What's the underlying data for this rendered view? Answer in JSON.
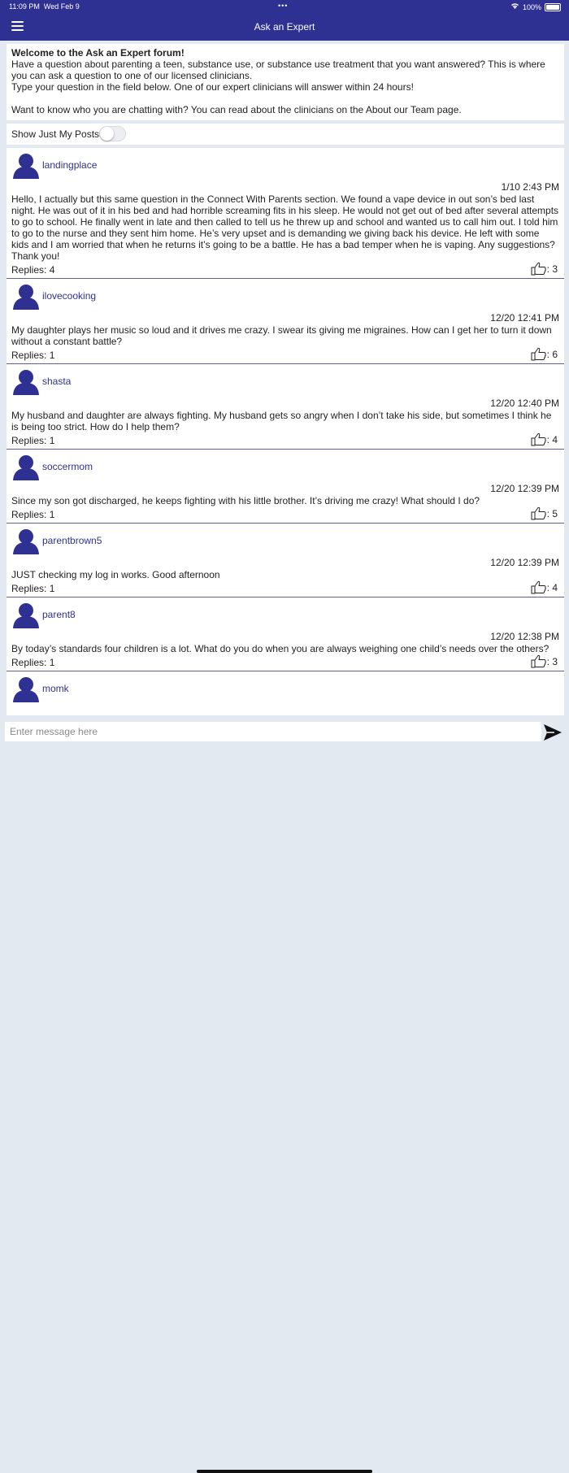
{
  "status_bar": {
    "time": "11:09 PM",
    "date": "Wed Feb 9",
    "dots": "•••",
    "wifi_icon": "wifi-icon",
    "battery": "100%"
  },
  "nav": {
    "title": "Ask an Expert",
    "menu_icon": "hamburger-icon"
  },
  "colors": {
    "brand": "#2e3191",
    "background": "#e3e9f1",
    "divider": "#5d6098"
  },
  "welcome": {
    "heading": "Welcome to the Ask an Expert forum!",
    "line1": "Have a question about parenting a teen, substance use, or substance use treatment that you want answered? This is where you can ask a question to one of our licensed clinicians.",
    "line2": "Type your question in the field below. One of our expert clinicians will answer within 24 hours!",
    "line3": "Want to know who you are chatting with? You can read about the clinicians on the About our Team page."
  },
  "filter": {
    "label": "Show Just My Posts",
    "enabled": false
  },
  "posts": [
    {
      "username": "landingplace",
      "time": "1/10 2:43 PM",
      "body": "Hello, I actually but this same question in the Connect With Parents section. We found a vape device in out son’s bed last night. He was out of it in his bed and had horrible screaming fits in his sleep. He would not get out of bed after several attempts to go to school. He finally went in late and then called to tell us he threw up and school and wanted us to call him out. I told him to go to the nurse and they sent him home. He’s very upset and is demanding we giving back his device. He left with some kids and I am worried that when he returns it’s going to be a battle. He has a bad temper when he is vaping. Any suggestions? Thank you!",
      "replies": "Replies: 4",
      "likes": ": 3"
    },
    {
      "username": "ilovecooking",
      "time": "12/20 12:41 PM",
      "body": "My daughter plays her music so loud and it drives me crazy. I swear its giving me migraines. How can I get her to turn it down without a constant battle?",
      "replies": "Replies: 1",
      "likes": ": 6"
    },
    {
      "username": "shasta",
      "time": "12/20 12:40 PM",
      "body": "My husband and daughter are always fighting. My husband gets so angry when I don’t take his side, but sometimes I think he is being too strict. How do I help them?",
      "replies": "Replies: 1",
      "likes": ": 4"
    },
    {
      "username": "soccermom",
      "time": "12/20 12:39 PM",
      "body": "Since my son got discharged, he keeps fighting with his little brother. It’s driving me crazy! What should I do?",
      "replies": "Replies: 1",
      "likes": ": 5"
    },
    {
      "username": "parentbrown5",
      "time": "12/20 12:39 PM",
      "body": "JUST checking my log in works. Good afternoon",
      "replies": "Replies: 1",
      "likes": ": 4"
    },
    {
      "username": "parent8",
      "time": "12/20 12:38 PM",
      "body": "By today’s standards four children is a lot. What do you do when you are always weighing one child’s needs over the others?",
      "replies": "Replies: 1",
      "likes": ": 3"
    },
    {
      "username": "momk",
      "time": "",
      "body": "",
      "replies": "",
      "likes": ""
    }
  ],
  "composer": {
    "placeholder": "Enter message here",
    "send_icon": "send-icon"
  }
}
